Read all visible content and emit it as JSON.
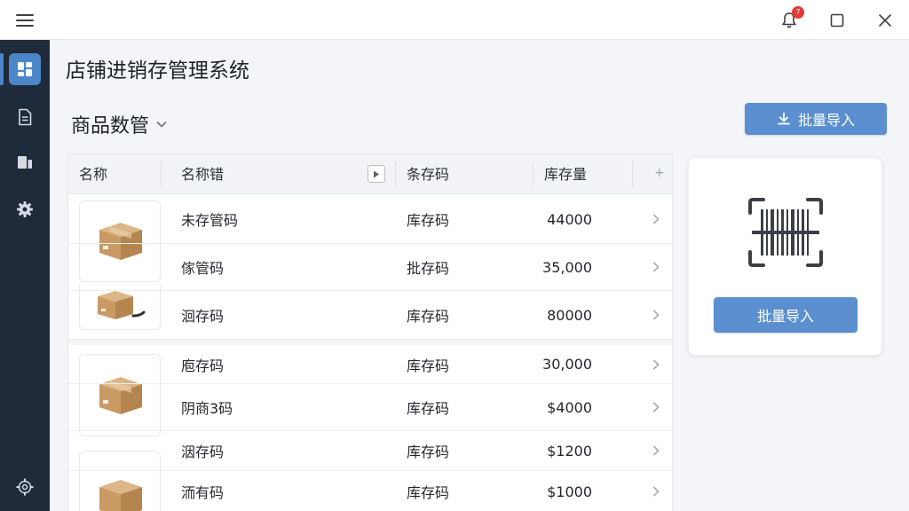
{
  "titlebar": {
    "notification_count": "7",
    "icons": {
      "menu": "hamburger-icon",
      "bell": "bell-icon",
      "maximize": "maximize-icon",
      "close": "close-icon"
    }
  },
  "sidebar": {
    "items": [
      {
        "icon": "dashboard-icon",
        "active": true
      },
      {
        "icon": "document-icon",
        "active": false
      },
      {
        "icon": "inventory-icon",
        "active": false
      },
      {
        "icon": "gear-icon",
        "active": false
      }
    ],
    "bottom_icon": "settings-icon"
  },
  "app": {
    "title": "店铺进销存管理系统"
  },
  "section": {
    "title": "商品数管"
  },
  "toolbar": {
    "import_label": "批量导入"
  },
  "table": {
    "headers": {
      "image": "名称",
      "name": "名称错",
      "code": "条存码",
      "qty": "库存量"
    },
    "rows": [
      {
        "name": "未存管码",
        "code": "库存码",
        "qty": "44000"
      },
      {
        "name": "傢管码",
        "code": "批存码",
        "qty": "35,000"
      },
      {
        "name": "洄存码",
        "code": "库存码",
        "qty": "80000"
      },
      {
        "name": "庖存码",
        "code": "库存码",
        "qty": "30,000"
      },
      {
        "name": "阴商3码",
        "code": "库存码",
        "qty": "$4000"
      },
      {
        "name": "洇存码",
        "code": "库存码",
        "qty": "$1200"
      },
      {
        "name": "洏有码",
        "code": "库存码",
        "qty": "$1000"
      }
    ]
  },
  "scan_card": {
    "icon": "barcode-scan-icon",
    "button_label": "批量导入"
  },
  "colors": {
    "accent": "#5b8fd0",
    "sidebar": "#1f2a3a",
    "badge": "#e53935"
  }
}
